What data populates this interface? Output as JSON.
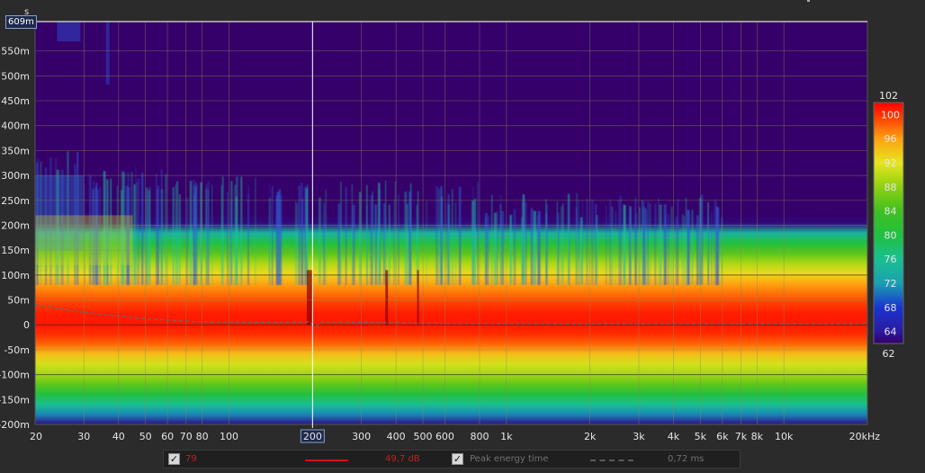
{
  "chart_data": {
    "type": "heatmap",
    "plot_kind": "spectrogram",
    "x_axis": {
      "scale": "log",
      "unit": "Hz",
      "range": [
        20,
        20000
      ],
      "ticks": [
        {
          "value": 20,
          "label": "20"
        },
        {
          "value": 30,
          "label": "30"
        },
        {
          "value": 40,
          "label": "40"
        },
        {
          "value": 50,
          "label": "50"
        },
        {
          "value": 60,
          "label": "60"
        },
        {
          "value": 70,
          "label": "70"
        },
        {
          "value": 80,
          "label": "80"
        },
        {
          "value": 100,
          "label": "100"
        },
        {
          "value": 300,
          "label": "300"
        },
        {
          "value": 400,
          "label": "400"
        },
        {
          "value": 500,
          "label": "500"
        },
        {
          "value": 600,
          "label": "600"
        },
        {
          "value": 800,
          "label": "800"
        },
        {
          "value": 1000,
          "label": "1k"
        },
        {
          "value": 2000,
          "label": "2k"
        },
        {
          "value": 3000,
          "label": "3k"
        },
        {
          "value": 4000,
          "label": "4k"
        },
        {
          "value": 5000,
          "label": "5k"
        },
        {
          "value": 6000,
          "label": "6k"
        },
        {
          "value": 7000,
          "label": "7k"
        },
        {
          "value": 8000,
          "label": "8k"
        },
        {
          "value": 10000,
          "label": "10k"
        },
        {
          "value": 20000,
          "label": "20kHz"
        }
      ]
    },
    "y_axis": {
      "unit": "s",
      "unit_label": "s",
      "range": [
        -0.2,
        0.609
      ],
      "ticks": [
        {
          "value": 0.55,
          "label": "550m"
        },
        {
          "value": 0.5,
          "label": "500m"
        },
        {
          "value": 0.45,
          "label": "450m"
        },
        {
          "value": 0.4,
          "label": "400m"
        },
        {
          "value": 0.35,
          "label": "350m"
        },
        {
          "value": 0.3,
          "label": "300m"
        },
        {
          "value": 0.25,
          "label": "250m"
        },
        {
          "value": 0.2,
          "label": "200m"
        },
        {
          "value": 0.15,
          "label": "150m"
        },
        {
          "value": 0.1,
          "label": "100m"
        },
        {
          "value": 0.05,
          "label": "50m"
        },
        {
          "value": 0,
          "label": "0"
        },
        {
          "value": -0.05,
          "label": "-50m"
        },
        {
          "value": -0.1,
          "label": "-100m"
        },
        {
          "value": -0.15,
          "label": "-150m"
        },
        {
          "value": -0.2,
          "label": "-200m"
        }
      ],
      "max_label": "609m"
    },
    "cursor": {
      "x_value": 200,
      "x_label": "200"
    },
    "colorbar": {
      "unit": "dB",
      "range": [
        62,
        102
      ],
      "min_label": "62",
      "max_label": "102",
      "ticks": [
        {
          "value": 100,
          "label": "100"
        },
        {
          "value": 96,
          "label": "96"
        },
        {
          "value": 92,
          "label": "92"
        },
        {
          "value": 88,
          "label": "88"
        },
        {
          "value": 84,
          "label": "84"
        },
        {
          "value": 80,
          "label": "80"
        },
        {
          "value": 76,
          "label": "76"
        },
        {
          "value": 72,
          "label": "72"
        },
        {
          "value": 68,
          "label": "68"
        },
        {
          "value": 64,
          "label": "64"
        }
      ],
      "stops": [
        {
          "value": 62,
          "color": "#35006a"
        },
        {
          "value": 64,
          "color": "#2a1aa0"
        },
        {
          "value": 68,
          "color": "#1a35d0"
        },
        {
          "value": 72,
          "color": "#1aa0b0"
        },
        {
          "value": 76,
          "color": "#1ac090"
        },
        {
          "value": 80,
          "color": "#20c040"
        },
        {
          "value": 84,
          "color": "#40c020"
        },
        {
          "value": 88,
          "color": "#90d010"
        },
        {
          "value": 92,
          "color": "#e6e620"
        },
        {
          "value": 96,
          "color": "#ffa010"
        },
        {
          "value": 100,
          "color": "#ff3000"
        },
        {
          "value": 102,
          "color": "#ff0000"
        }
      ]
    },
    "peak_energy_time_s": [
      {
        "f": 20,
        "t": 0.04
      },
      {
        "f": 30,
        "t": 0.025
      },
      {
        "f": 50,
        "t": 0.012
      },
      {
        "f": 80,
        "t": 0.006
      },
      {
        "f": 150,
        "t": 0.004
      },
      {
        "f": 195,
        "t": 0.006
      },
      {
        "f": 205,
        "t": -0.004
      },
      {
        "f": 215,
        "t": 0.006
      },
      {
        "f": 500,
        "t": 0.003
      },
      {
        "f": 2000,
        "t": 0.002
      },
      {
        "f": 20000,
        "t": 0.002
      }
    ]
  },
  "legend": {
    "trace_checked": true,
    "trace_name": "79",
    "trace_value": "49,7 dB",
    "peak_checked": true,
    "peak_label": "Peak energy time",
    "peak_value": "0,72 ms"
  },
  "colors": {
    "background": "#2b2b2b",
    "plot_floor": "#35006a",
    "grid": "#8a8a5a",
    "trace_red": "#d01010",
    "peak_line": "#666666"
  }
}
